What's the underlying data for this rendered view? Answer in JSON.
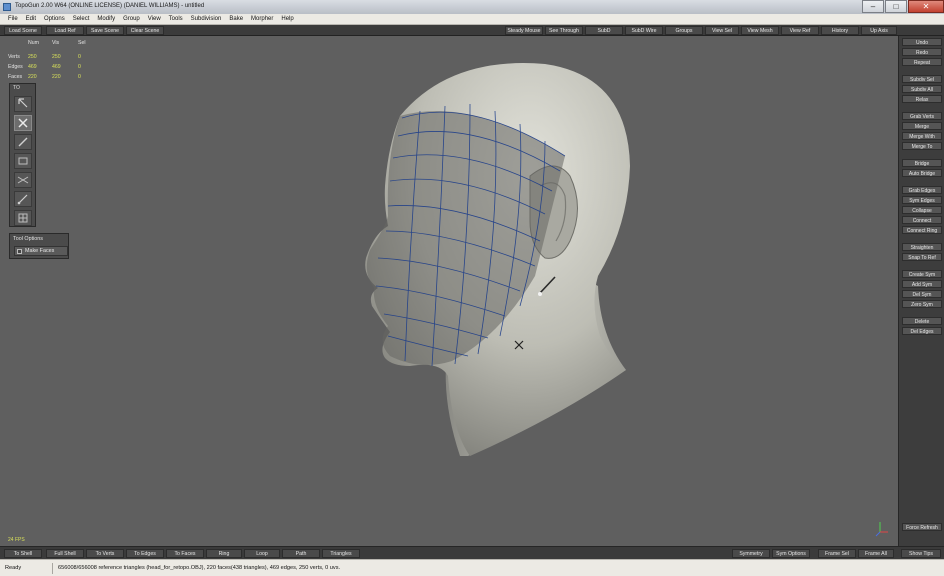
{
  "window": {
    "title": "TopoGun 2.00 W64 (ONLINE LICENSE) (DANIEL WILLIAMS) - untitled",
    "minimize_glyph": "–",
    "maximize_glyph": "□",
    "close_glyph": "✕"
  },
  "menu": [
    "File",
    "Edit",
    "Options",
    "Select",
    "Modify",
    "Group",
    "View",
    "Tools",
    "Subdivision",
    "Bake",
    "Morpher",
    "Help"
  ],
  "toolbar": {
    "left": [
      "Load Scene",
      "Load Ref",
      "Save Scene",
      "Clear Scene"
    ],
    "right": [
      "Steady Mouse",
      "See Through",
      "SubD",
      "SubD Wire",
      "Groups",
      "View Sel",
      "View Mesh",
      "View Ref",
      "History",
      "Up Axis"
    ]
  },
  "stats": {
    "headers": [
      "Num",
      "Vis",
      "Sel"
    ],
    "rows": [
      {
        "label": "Verts",
        "num": "250",
        "vis": "250",
        "sel": "0"
      },
      {
        "label": "Edges",
        "num": "469",
        "vis": "469",
        "sel": "0"
      },
      {
        "label": "Faces",
        "num": "220",
        "vis": "220",
        "sel": "0"
      }
    ]
  },
  "toolbox": {
    "title": "TO",
    "tools": [
      "select-arrow-icon",
      "cross-tool-icon",
      "pen-tool-icon",
      "brush-tool-icon",
      "mesh-tool-icon",
      "draw-tool-icon",
      "grid-tool-icon"
    ],
    "active_index": 1
  },
  "tool_options": {
    "title": "Tool Options",
    "checkbox_label": "Make Faces"
  },
  "right_panel": [
    "Undo",
    "Redo",
    "Repeat",
    "Subdiv Sel",
    "Subdiv All",
    "Relax",
    "Grab Verts",
    "Merge",
    "Merge With",
    "Merge To",
    "Bridge",
    "Auto Bridge",
    "Grab Edges",
    "Sym Edges",
    "Collapse",
    "Connect",
    "Connect Ring",
    "Straighten",
    "Snap To Ref",
    "Create Sym",
    "Add Sym",
    "Del Sym",
    "Zero Sym",
    "Delete",
    "Del Edges",
    "Force Refresh"
  ],
  "fps": "24 FPS",
  "bottom_bar": {
    "left": [
      "To Shell",
      "Full Shell",
      "To Verts",
      "To Edges",
      "To Faces",
      "Ring",
      "Loop",
      "Path",
      "Triangles"
    ],
    "right": [
      "Symmetry",
      "Sym Options",
      "Frame Sel",
      "Frame All",
      "Show Tips"
    ]
  },
  "status": {
    "state": "Ready",
    "message": "656008/656008 reference triangles (head_for_retopo.OBJ), 220 faces(438 triangles), 469 edges, 250 verts, 0 uvs."
  },
  "colors": {
    "viewport_bg": "#5f5f5f",
    "panel_bg": "#3d3d3d",
    "stat_value": "#d8e05a",
    "wire": "#1d3d8a",
    "head_skin": "#c9c9c0"
  }
}
